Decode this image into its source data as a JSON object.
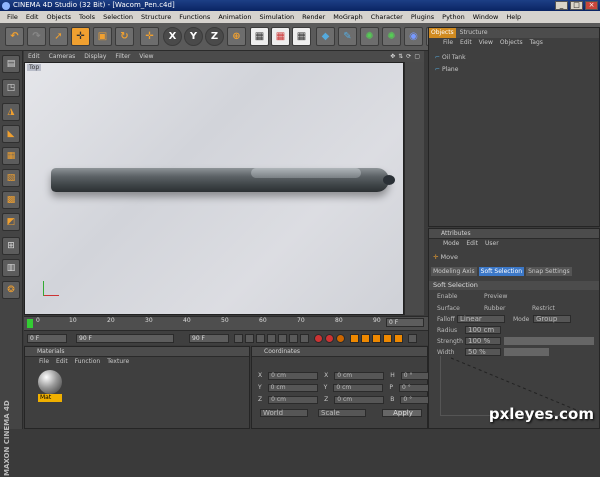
{
  "title": "CINEMA 4D Studio (32 Bit) - [Wacom_Pen.c4d]",
  "menu": [
    "File",
    "Edit",
    "Objects",
    "Tools",
    "Selection",
    "Structure",
    "Functions",
    "Animation",
    "Simulation",
    "Render",
    "MoGraph",
    "Character",
    "Plugins",
    "Python",
    "Window",
    "Help"
  ],
  "viewport": {
    "menu": [
      "Edit",
      "Cameras",
      "Display",
      "Filter",
      "View"
    ],
    "label": "Top"
  },
  "timeline": {
    "ticks": [
      "0",
      "10",
      "20",
      "30",
      "40",
      "50",
      "60",
      "70",
      "80",
      "90"
    ],
    "end": "0 F",
    "f1": "0 F",
    "f2": "90 F",
    "f3": "90 F",
    "f4": "0 F"
  },
  "objects_panel": {
    "tabs": [
      "Objects",
      "Structure"
    ],
    "menu": [
      "File",
      "Edit",
      "View",
      "Objects",
      "Tags"
    ],
    "items": [
      "Oil Tank",
      "Plane"
    ]
  },
  "attributes": {
    "title": "Attributes",
    "menu": [
      "Mode",
      "Edit",
      "User"
    ],
    "tool": "Move",
    "tabs": [
      "Modeling Axis",
      "Soft Selection",
      "Snap Settings"
    ],
    "section": "Soft Selection",
    "rows": {
      "enable": "Enable",
      "preview": "Preview",
      "surface": "Surface",
      "rubber": "Rubber",
      "restrict": "Restrict",
      "falloff": "Falloff",
      "falloff_val": "Linear",
      "mode": "Mode",
      "mode_val": "Group",
      "radius": "Radius",
      "radius_val": "100 cm",
      "strength": "Strength",
      "strength_val": "100 %",
      "width": "Width",
      "width_val": "50 %"
    }
  },
  "materials": {
    "title": "Materials",
    "menu": [
      "File",
      "Edit",
      "Function",
      "Texture"
    ],
    "mat": "Mat"
  },
  "coordinates": {
    "title": "Coordinates",
    "rows": [
      [
        "X",
        "0 cm",
        "X",
        "0 cm",
        "H",
        "0 °"
      ],
      [
        "Y",
        "0 cm",
        "Y",
        "0 cm",
        "P",
        "0 °"
      ],
      [
        "Z",
        "0 cm",
        "Z",
        "0 cm",
        "B",
        "0 °"
      ]
    ],
    "world": "World",
    "scale": "Scale",
    "apply": "Apply"
  },
  "watermark": "pxleyes.com",
  "side_logo": "MAXON CINEMA 4D"
}
